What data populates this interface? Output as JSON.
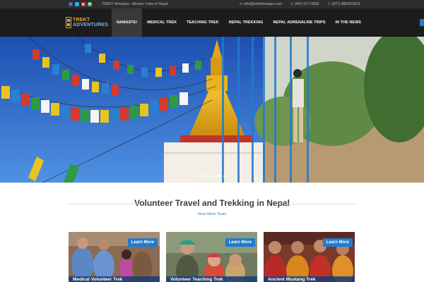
{
  "topbar": {
    "social": [
      {
        "name": "facebook",
        "glyph": "f",
        "color": "#3b5998"
      },
      {
        "name": "twitter",
        "glyph": "t",
        "color": "#1da1f2"
      },
      {
        "name": "youtube",
        "glyph": "▶",
        "color": "#d8352c"
      },
      {
        "name": "email",
        "glyph": "✉",
        "color": "#4caf50"
      }
    ],
    "tagline": "TREKT Himalaya - Mission Treks in Nepal",
    "email": "info@trekthimalaya.com",
    "phone1": "(407) 377-6826",
    "phone2": "(977) 9803018011"
  },
  "logo": {
    "line1": "TREKT",
    "line2": "ADVENTURES"
  },
  "nav": {
    "items": [
      {
        "label": "NAMASTE!",
        "active": true
      },
      {
        "label": "MEDICAL TREK",
        "active": false
      },
      {
        "label": "TEACHING TREK",
        "active": false
      },
      {
        "label": "NEPAL TREKKING",
        "active": false
      },
      {
        "label": "NEPAL ADRENALINE TRIPS",
        "active": false
      },
      {
        "label": "IN THE NEWS",
        "active": false
      }
    ]
  },
  "slider": {
    "slides": 6,
    "active_slide": 4
  },
  "section": {
    "title": "Volunteer Travel and Trekking in Nepal",
    "link": "View More Tours"
  },
  "cards": [
    {
      "caption": "Medical Volunteer Trek",
      "button": "Learn More"
    },
    {
      "caption": "Volunteer Teaching Trek",
      "button": "Learn More"
    },
    {
      "caption": "Ancient Mustang Trek",
      "button": "Learn More"
    }
  ],
  "colors": {
    "accent": "#1f7bd0",
    "topbar": "#2d2d2d",
    "navbar": "#1c1c1c"
  }
}
